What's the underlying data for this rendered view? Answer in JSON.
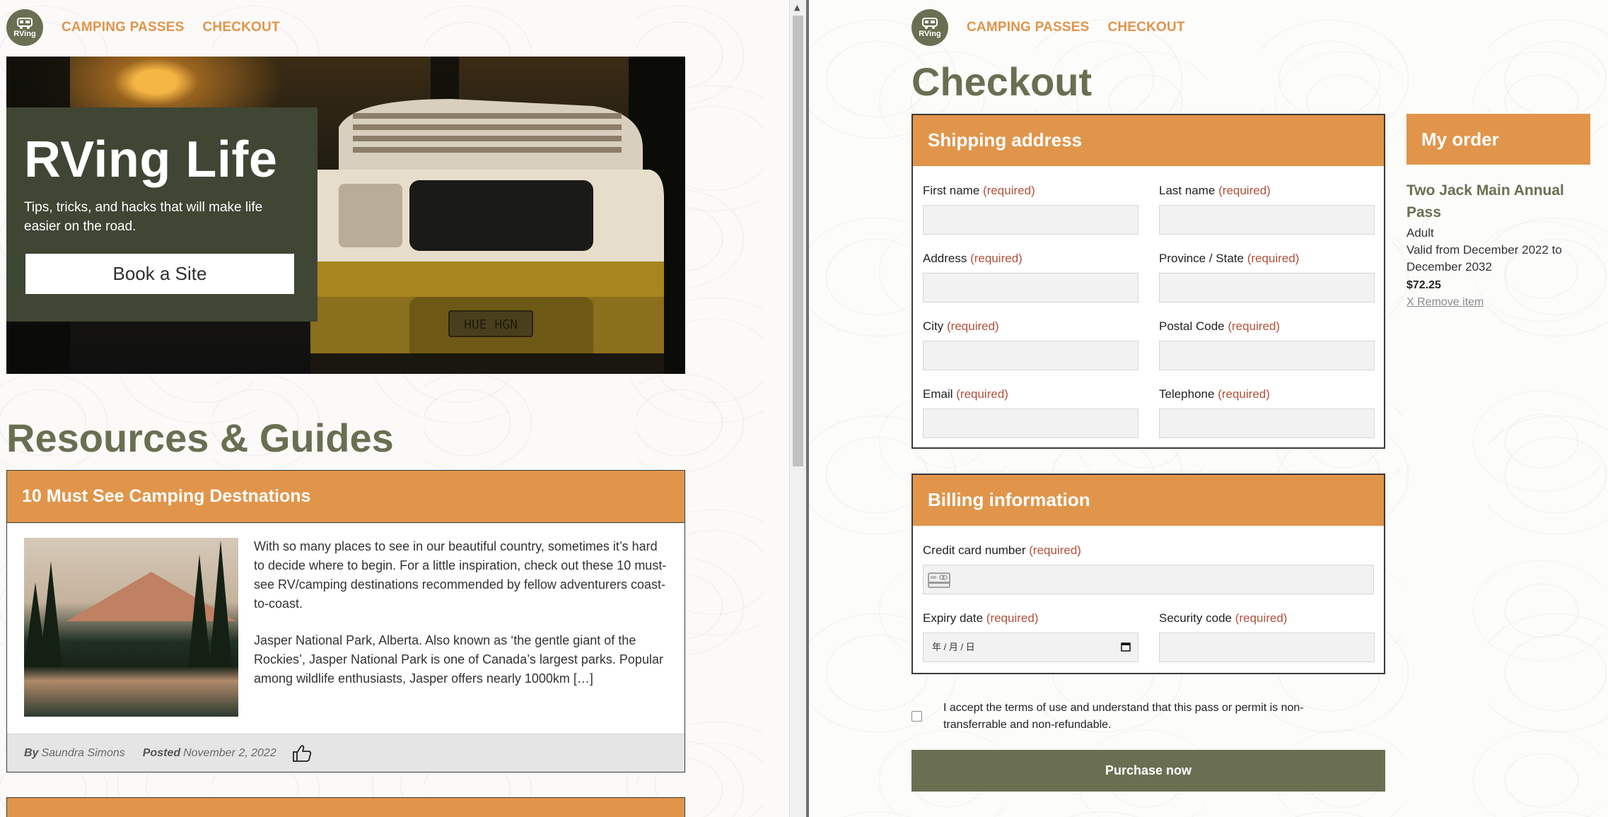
{
  "left": {
    "nav": {
      "logo_text": "RVing",
      "links": [
        "CAMPING PASSES",
        "CHECKOUT"
      ]
    },
    "hero": {
      "title": "RVing Life",
      "subtitle": "Tips, tricks, and hacks that will make life easier on the road.",
      "button": "Book a Site",
      "van_plate": "HUE HGN"
    },
    "resources": {
      "title": "Resources & Guides",
      "cards": [
        {
          "title": "10 Must See Camping Destnations",
          "paragraphs": [
            "With so many places to see in our beautiful country, sometimes it’s hard to decide where to begin. For a little inspiration, check out these 10 must-see RV/camping destinations recommended by fellow adventurers coast-to-coast.",
            "Jasper National Park, Alberta. Also known as ‘the gentle giant of the Rockies’, Jasper National Park is one of Canada’s largest parks. Popular among wildlife enthusiasts, Jasper offers nearly 1000km […]"
          ],
          "by_label": "By",
          "author": "Saundra Simons",
          "posted_label": "Posted",
          "date": "November 2, 2022"
        }
      ]
    }
  },
  "right": {
    "nav": {
      "logo_text": "RVing",
      "links": [
        "CAMPING PASSES",
        "CHECKOUT"
      ]
    },
    "title": "Checkout",
    "required_tag": "(required)",
    "shipping": {
      "heading": "Shipping address",
      "fields": {
        "first_name": "First name",
        "last_name": "Last name",
        "address": "Address",
        "province": "Province / State",
        "city": "City",
        "postal": "Postal Code",
        "email": "Email",
        "telephone": "Telephone"
      }
    },
    "billing": {
      "heading": "Billing information",
      "fields": {
        "card_number": "Credit card number",
        "expiry": "Expiry date",
        "security": "Security code"
      },
      "expiry_placeholder": "年 / 月 / 日"
    },
    "terms": "I accept the terms of use and understand that this pass or permit is non-transferrable and non-refundable.",
    "purchase_button": "Purchase now",
    "order": {
      "heading": "My order",
      "item_name": "Two Jack Main Annual Pass",
      "type": "Adult",
      "validity": "Valid from December 2022 to December 2032",
      "price": "$72.25",
      "remove": "X Remove item"
    }
  },
  "colors": {
    "accent": "#e0954b",
    "olive": "#6b6f52",
    "hero_card": "#3f4634",
    "required": "#b1503a"
  }
}
